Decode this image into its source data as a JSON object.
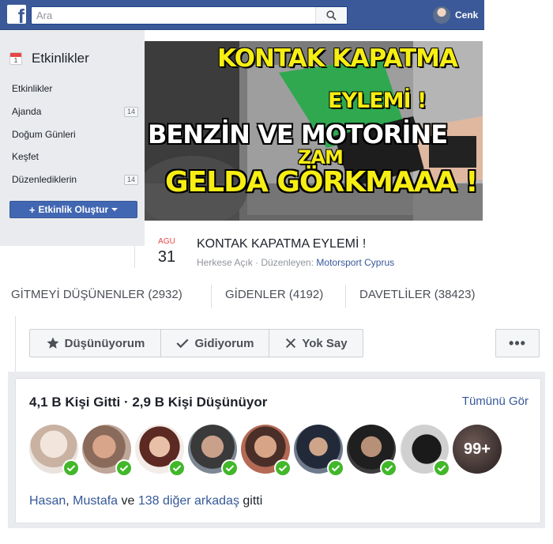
{
  "topbar": {
    "search_placeholder": "Ara",
    "user_name": "Cenk"
  },
  "sidebar": {
    "title": "Etkinlikler",
    "calendar_day": "1",
    "items": [
      {
        "label": "Etkinlikler",
        "badge": ""
      },
      {
        "label": "Ajanda",
        "badge": "14"
      },
      {
        "label": "Doğum Günleri",
        "badge": ""
      },
      {
        "label": "Keşfet",
        "badge": ""
      },
      {
        "label": "Düzenlediklerin",
        "badge": "14"
      }
    ],
    "create_button": "Etkinlik Oluştur"
  },
  "banner": {
    "lines": [
      "KONTAK KAPATMA",
      "EYLEMİ !",
      "BENZİN VE MOTORİNE",
      "ZAM",
      "GELDA GÖRKMAAA !"
    ]
  },
  "event": {
    "month": "AGU",
    "day": "31",
    "title": "KONTAK KAPATMA EYLEMİ !",
    "meta_prefix": "Herkese Açık · Düzenleyen:",
    "organizer": "Motorsport Cyprus"
  },
  "tabs": [
    {
      "label": "GİTMEYİ DÜŞÜNENLER (2932)"
    },
    {
      "label": "GİDENLER (4192)"
    },
    {
      "label": "DAVETLİLER (38423)"
    }
  ],
  "actions": {
    "interested": "Düşünüyorum",
    "going": "Gidiyorum",
    "ignore": "Yok Say",
    "more": "•••"
  },
  "friends": {
    "heading": "4,1 B Kişi Gitti · 2,9 B Kişi Düşünüyor",
    "see_all": "Tümünü Gör",
    "more_count": "99+",
    "name1": "Hasan",
    "sep": ", ",
    "name2": "Mustafa",
    "and": " ve ",
    "others": "138 diğer arkadaş",
    "suffix": " gitti"
  },
  "colors": {
    "brand": "#3b5998",
    "link": "#365899",
    "check": "#42b72a",
    "month": "#e64646"
  }
}
